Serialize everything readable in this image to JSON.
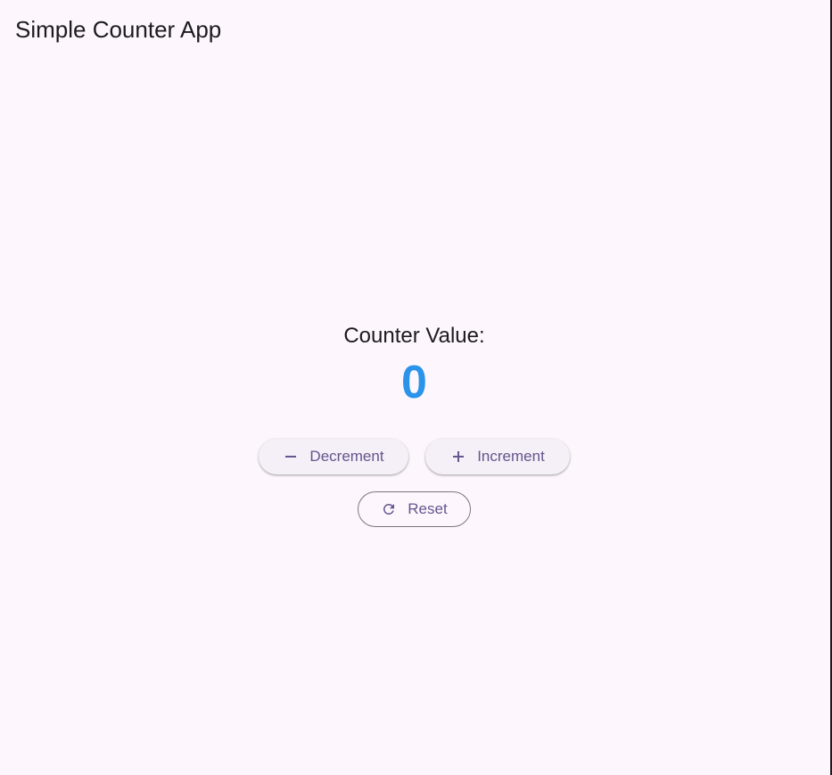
{
  "app_bar": {
    "title": "Simple Counter App"
  },
  "counter": {
    "label": "Counter Value:",
    "value": "0",
    "value_color": "#2b94ea"
  },
  "buttons": {
    "decrement": {
      "label": "Decrement",
      "icon": "minus-icon"
    },
    "increment": {
      "label": "Increment",
      "icon": "plus-icon"
    },
    "reset": {
      "label": "Reset",
      "icon": "refresh-icon"
    }
  },
  "colors": {
    "background": "#fdf7fd",
    "accent": "#66558e",
    "text": "#1d1b20"
  }
}
